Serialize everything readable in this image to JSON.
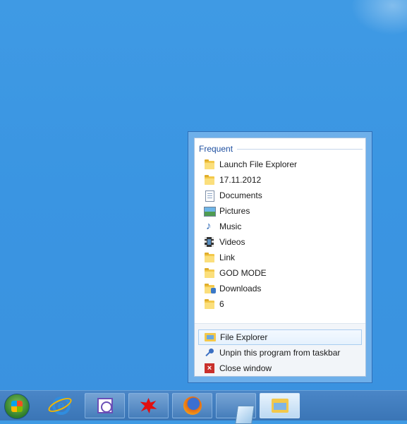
{
  "jump_list": {
    "section_title": "Frequent",
    "frequent_items": [
      {
        "label": "Launch File Explorer",
        "icon": "folder-icon"
      },
      {
        "label": "17.11.2012",
        "icon": "folder-icon"
      },
      {
        "label": "Documents",
        "icon": "documents-icon"
      },
      {
        "label": "Pictures",
        "icon": "pictures-icon"
      },
      {
        "label": "Music",
        "icon": "music-icon"
      },
      {
        "label": "Videos",
        "icon": "videos-icon"
      },
      {
        "label": "Link",
        "icon": "folder-icon"
      },
      {
        "label": "GOD MODE",
        "icon": "folder-icon"
      },
      {
        "label": "Downloads",
        "icon": "downloads-icon"
      },
      {
        "label": "6",
        "icon": "folder-icon"
      }
    ],
    "tasks": [
      {
        "label": "File Explorer",
        "icon": "file-explorer-icon"
      },
      {
        "label": "Unpin this program from taskbar",
        "icon": "unpin-icon"
      },
      {
        "label": "Close window",
        "icon": "close-window-icon"
      }
    ]
  },
  "taskbar": {
    "buttons": [
      {
        "name": "start-button",
        "icon": "windows-logo-icon"
      },
      {
        "name": "internet-explorer",
        "icon": "internet-explorer-icon"
      },
      {
        "name": "visual-studio",
        "icon": "visual-studio-icon"
      },
      {
        "name": "red-splat-app",
        "icon": "red-splat-icon"
      },
      {
        "name": "firefox",
        "icon": "firefox-icon"
      },
      {
        "name": "notepad-app",
        "icon": "paper-icon"
      },
      {
        "name": "file-explorer",
        "icon": "file-explorer-icon",
        "active": true
      }
    ]
  },
  "colors": {
    "desktop": "#3a95e2",
    "taskbar": "#3f7dbf",
    "header_text": "#1e4fa0",
    "close_red": "#c9302c"
  }
}
